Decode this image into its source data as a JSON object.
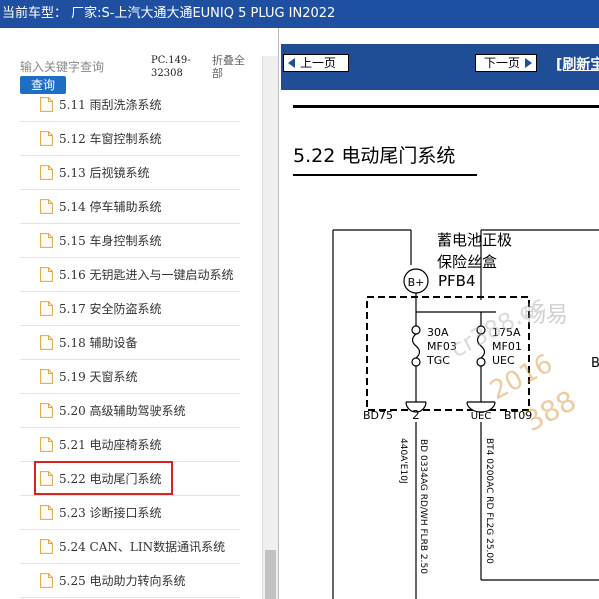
{
  "titlebar": {
    "text": "当前车型： 厂家:S-上汽大通大通EUNIQ 5 PLUG IN2022"
  },
  "search": {
    "placeholder": "输入关键字查询",
    "button": "查询"
  },
  "catalog_code": "PC.149-32308",
  "fold_all": "折叠全部",
  "tree": {
    "items": [
      {
        "label": "5.11 雨刮洗涤系统"
      },
      {
        "label": "5.12 车窗控制系统"
      },
      {
        "label": "5.13 后视镜系统"
      },
      {
        "label": "5.14 停车辅助系统"
      },
      {
        "label": "5.15 车身控制系统"
      },
      {
        "label": "5.16 无钥匙进入与一键启动系统"
      },
      {
        "label": "5.17 安全防盗系统"
      },
      {
        "label": "5.18 辅助设备"
      },
      {
        "label": "5.19 天窗系统"
      },
      {
        "label": "5.20 高级辅助驾驶系统"
      },
      {
        "label": "5.21 电动座椅系统"
      },
      {
        "label": "5.22 电动尾门系统"
      },
      {
        "label": "5.23 诊断接口系统"
      },
      {
        "label": "5.24 CAN、LIN数据通讯系统"
      },
      {
        "label": "5.25 电动助力转向系统"
      }
    ],
    "selected_index": 11
  },
  "nav": {
    "prev": "上一页",
    "next": "下一页",
    "refresh": "[刷新宝"
  },
  "document": {
    "section_title": "5.22 电动尾门系统",
    "fuse_box_label_line1": "蓄电池正极",
    "fuse_box_label_line2": "保险丝盒",
    "box_name": "PFB4",
    "terminal_b_plus": "B+",
    "fuse1_amp": "30A",
    "fuse1_code": "MF03",
    "fuse1_circuit": "TGC",
    "fuse2_amp": "175A",
    "fuse2_code": "MF01",
    "fuse2_circuit": "UEC",
    "pin_left": "2",
    "pin_right": "UEC",
    "conn_left": "BD75",
    "conn_right": "BT09",
    "wire_left": "BD 0334AG RD/WH FLRB 2.50",
    "wire_left_2": "440A'E10J",
    "wire_right": "BT4 0200AC RD FL2G 25.00",
    "edge_letter": "B",
    "watermark": [
      "畅易",
      "cr388.cc",
      "2016",
      "388"
    ]
  },
  "colors": {
    "titlebar": "#1e4fa1",
    "nav_bar": "#1f4d96",
    "highlight": "#d9231c",
    "search_button": "#1e6ec4"
  },
  "icons": [
    "document-icon",
    "arrow-left-icon",
    "arrow-right-icon"
  ]
}
